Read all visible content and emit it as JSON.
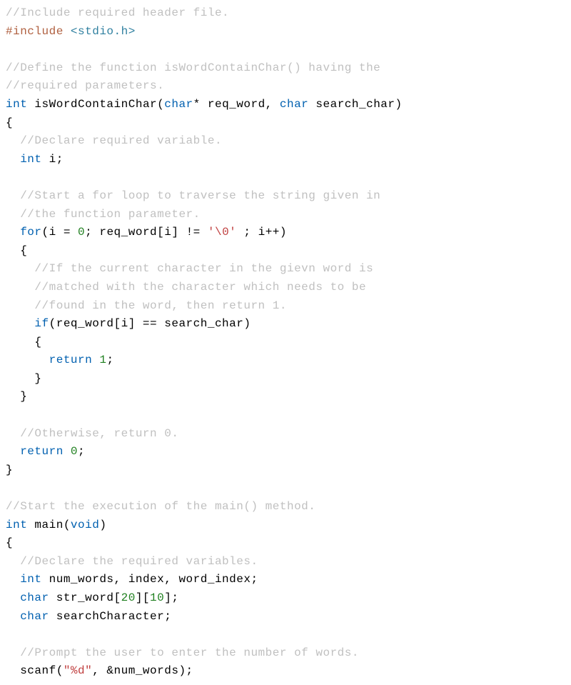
{
  "code": {
    "lines": [
      {
        "tokens": [
          {
            "type": "comment",
            "text": "//Include required header file."
          }
        ]
      },
      {
        "tokens": [
          {
            "type": "preprocessor",
            "text": "#include"
          },
          {
            "type": "plain",
            "text": " "
          },
          {
            "type": "header-file",
            "text": "<stdio.h>"
          }
        ]
      },
      {
        "tokens": []
      },
      {
        "tokens": [
          {
            "type": "comment",
            "text": "//Define the function isWordContainChar() having the"
          }
        ]
      },
      {
        "tokens": [
          {
            "type": "comment",
            "text": "//required parameters."
          }
        ]
      },
      {
        "tokens": [
          {
            "type": "keyword",
            "text": "int"
          },
          {
            "type": "plain",
            "text": " isWordContainChar("
          },
          {
            "type": "keyword",
            "text": "char"
          },
          {
            "type": "plain",
            "text": "* req_word, "
          },
          {
            "type": "keyword",
            "text": "char"
          },
          {
            "type": "plain",
            "text": " search_char)"
          }
        ]
      },
      {
        "tokens": [
          {
            "type": "plain",
            "text": "{"
          }
        ]
      },
      {
        "tokens": [
          {
            "type": "plain",
            "text": "  "
          },
          {
            "type": "comment",
            "text": "//Declare required variable."
          }
        ]
      },
      {
        "tokens": [
          {
            "type": "plain",
            "text": "  "
          },
          {
            "type": "keyword",
            "text": "int"
          },
          {
            "type": "plain",
            "text": " i;"
          }
        ]
      },
      {
        "tokens": []
      },
      {
        "tokens": [
          {
            "type": "plain",
            "text": "  "
          },
          {
            "type": "comment",
            "text": "//Start a for loop to traverse the string given in"
          }
        ]
      },
      {
        "tokens": [
          {
            "type": "plain",
            "text": "  "
          },
          {
            "type": "comment",
            "text": "//the function parameter."
          }
        ]
      },
      {
        "tokens": [
          {
            "type": "plain",
            "text": "  "
          },
          {
            "type": "keyword",
            "text": "for"
          },
          {
            "type": "plain",
            "text": "(i = "
          },
          {
            "type": "number",
            "text": "0"
          },
          {
            "type": "plain",
            "text": "; req_word[i] != "
          },
          {
            "type": "char-literal",
            "text": "'\\0'"
          },
          {
            "type": "plain",
            "text": " ; i++)"
          }
        ]
      },
      {
        "tokens": [
          {
            "type": "plain",
            "text": "  {"
          }
        ]
      },
      {
        "tokens": [
          {
            "type": "plain",
            "text": "    "
          },
          {
            "type": "comment",
            "text": "//If the current character in the gievn word is"
          }
        ]
      },
      {
        "tokens": [
          {
            "type": "plain",
            "text": "    "
          },
          {
            "type": "comment",
            "text": "//matched with the character which needs to be"
          }
        ]
      },
      {
        "tokens": [
          {
            "type": "plain",
            "text": "    "
          },
          {
            "type": "comment",
            "text": "//found in the word, then return 1."
          }
        ]
      },
      {
        "tokens": [
          {
            "type": "plain",
            "text": "    "
          },
          {
            "type": "keyword",
            "text": "if"
          },
          {
            "type": "plain",
            "text": "(req_word[i] == search_char)"
          }
        ]
      },
      {
        "tokens": [
          {
            "type": "plain",
            "text": "    {"
          }
        ]
      },
      {
        "tokens": [
          {
            "type": "plain",
            "text": "      "
          },
          {
            "type": "keyword",
            "text": "return"
          },
          {
            "type": "plain",
            "text": " "
          },
          {
            "type": "number",
            "text": "1"
          },
          {
            "type": "plain",
            "text": ";"
          }
        ]
      },
      {
        "tokens": [
          {
            "type": "plain",
            "text": "    }"
          }
        ]
      },
      {
        "tokens": [
          {
            "type": "plain",
            "text": "  }"
          }
        ]
      },
      {
        "tokens": []
      },
      {
        "tokens": [
          {
            "type": "plain",
            "text": "  "
          },
          {
            "type": "comment",
            "text": "//Otherwise, return 0."
          }
        ]
      },
      {
        "tokens": [
          {
            "type": "plain",
            "text": "  "
          },
          {
            "type": "keyword",
            "text": "return"
          },
          {
            "type": "plain",
            "text": " "
          },
          {
            "type": "number",
            "text": "0"
          },
          {
            "type": "plain",
            "text": ";"
          }
        ]
      },
      {
        "tokens": [
          {
            "type": "plain",
            "text": "}"
          }
        ]
      },
      {
        "tokens": []
      },
      {
        "tokens": [
          {
            "type": "comment",
            "text": "//Start the execution of the main() method."
          }
        ]
      },
      {
        "tokens": [
          {
            "type": "keyword",
            "text": "int"
          },
          {
            "type": "plain",
            "text": " main("
          },
          {
            "type": "keyword",
            "text": "void"
          },
          {
            "type": "plain",
            "text": ")"
          }
        ]
      },
      {
        "tokens": [
          {
            "type": "plain",
            "text": "{"
          }
        ]
      },
      {
        "tokens": [
          {
            "type": "plain",
            "text": "  "
          },
          {
            "type": "comment",
            "text": "//Declare the required variables."
          }
        ]
      },
      {
        "tokens": [
          {
            "type": "plain",
            "text": "  "
          },
          {
            "type": "keyword",
            "text": "int"
          },
          {
            "type": "plain",
            "text": " num_words, index, word_index;"
          }
        ]
      },
      {
        "tokens": [
          {
            "type": "plain",
            "text": "  "
          },
          {
            "type": "keyword",
            "text": "char"
          },
          {
            "type": "plain",
            "text": " str_word["
          },
          {
            "type": "number",
            "text": "20"
          },
          {
            "type": "plain",
            "text": "]["
          },
          {
            "type": "number",
            "text": "10"
          },
          {
            "type": "plain",
            "text": "];"
          }
        ]
      },
      {
        "tokens": [
          {
            "type": "plain",
            "text": "  "
          },
          {
            "type": "keyword",
            "text": "char"
          },
          {
            "type": "plain",
            "text": " searchCharacter;"
          }
        ]
      },
      {
        "tokens": []
      },
      {
        "tokens": [
          {
            "type": "plain",
            "text": "  "
          },
          {
            "type": "comment",
            "text": "//Prompt the user to enter the number of words."
          }
        ]
      },
      {
        "tokens": [
          {
            "type": "plain",
            "text": "  scanf("
          },
          {
            "type": "string",
            "text": "\"%d\""
          },
          {
            "type": "plain",
            "text": ", &num_words);"
          }
        ]
      }
    ]
  }
}
